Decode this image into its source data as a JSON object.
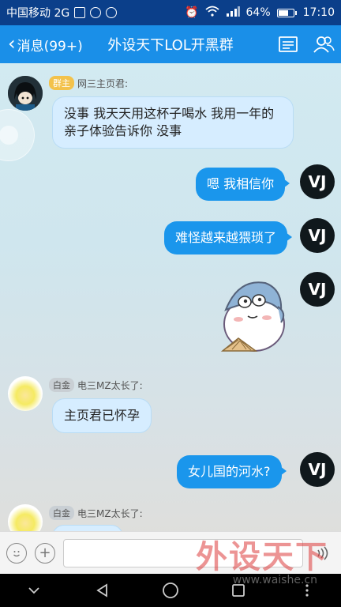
{
  "status_bar": {
    "carrier": "中国移动 2G",
    "network": "2G",
    "battery": "64%",
    "time": "17:10"
  },
  "header": {
    "back_label": "消息(99+)",
    "title": "外设天下LOL开黑群"
  },
  "messages": [
    {
      "side": "left",
      "badge": "群主",
      "sender": "网三主页君:",
      "text": "没事  我天天用这杯子喝水  我用一年的亲子体验告诉你 没事"
    },
    {
      "side": "right",
      "text": "嗯 我相信你"
    },
    {
      "side": "right",
      "text": "难怪越来越猥琐了"
    },
    {
      "side": "right",
      "type": "sticker"
    },
    {
      "side": "left",
      "badge": "白金",
      "sender": "电三MZ太长了:",
      "text": "主页君已怀孕"
    },
    {
      "side": "right",
      "text": "女儿国的河水?"
    },
    {
      "side": "left",
      "badge": "白金",
      "sender": "电三MZ太长了:"
    }
  ],
  "avatars": {
    "vj_label": "VJ"
  },
  "input": {
    "placeholder": ""
  },
  "watermark": {
    "text": "外设天下",
    "sub": "www.waishe.cn"
  },
  "colors": {
    "status_bar": "#0b3f8a",
    "title_bar": "#1a8fe8",
    "bubble_self": "#1a96ec",
    "bubble_other": "#d6edff"
  }
}
